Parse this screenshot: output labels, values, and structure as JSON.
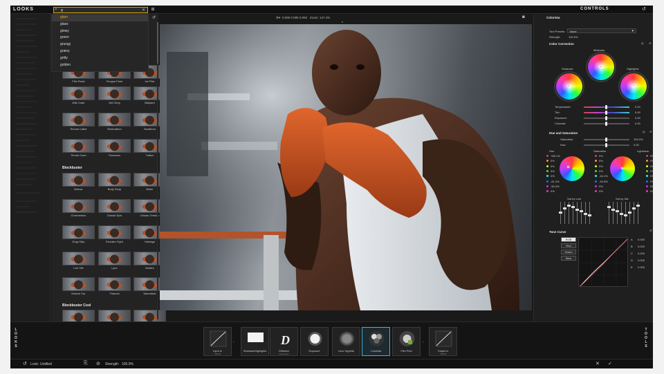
{
  "header": {
    "looks_title": "LOOKS",
    "controls_title": "CONTROLS"
  },
  "search": {
    "value": "g",
    "options": [
      "glam",
      "glass",
      "glowy",
      "green",
      "grungy",
      "grainy",
      "gritty",
      "golden"
    ],
    "selected": "glam"
  },
  "looks": {
    "rows": [
      [
        "Film Flash",
        "Fungus Farm",
        "Ice Pick"
      ],
      [
        "Milk Crate",
        "Old Glory",
        "Ballyard"
      ],
      [
        "Record Label",
        "Restoration",
        "Sandborn"
      ],
      [
        "Tennis Court",
        "Transonic",
        "Tuition"
      ],
      [
        "Bolivar",
        "Body Shop",
        "Boiler"
      ],
      [
        "Chromeleon",
        "Classic Epic",
        "Classic Tension"
      ],
      [
        "Drag Strip",
        "Elevator Fight",
        "Heritage"
      ],
      [
        "Live Die",
        "Lyon",
        "Mantra"
      ],
      [
        "Muscle Car",
        "Thames",
        "Warmfade"
      ]
    ],
    "groups": [
      "Blockbuster",
      "Blockbuster Cool"
    ]
  },
  "viewer": {
    "readout": "0.096   0.095   0.092",
    "zoom_label": "Zoom:",
    "zoom_value": "147.4%"
  },
  "controls": {
    "section_title": "Colorista",
    "tool_presets_label": "Tool Presets:",
    "tool_presets_value": "None",
    "strength_label": "Strength:",
    "strength_value": "100.0%",
    "color_correction": "Color Correction",
    "midtones": "Midtones",
    "shadows": "Shadows",
    "highlights": "Highlights",
    "sliders": [
      {
        "label": "Temperature:",
        "value": "0.00"
      },
      {
        "label": "Tint:",
        "value": "0.00"
      },
      {
        "label": "Exposure:",
        "value": "0.00"
      },
      {
        "label": "Contrast:",
        "value": "0.00"
      }
    ],
    "hue_sat": "Hue and Saturation",
    "hs_sliders": [
      {
        "label": "Saturation:",
        "value": "100.0%"
      },
      {
        "label": "Hue:",
        "value": "0.00"
      }
    ],
    "hue_label": "Hue",
    "saturation_label": "Saturation",
    "lightness_label": "Lightness",
    "hue_vals": [
      "+58.1%",
      "0%",
      "0%",
      "0%",
      "0%",
      "-61.2%",
      "-50.3%",
      "0%"
    ],
    "sat_vals": [
      "0%",
      "0%",
      "0%",
      "0%",
      "-16.1%",
      "-16.5%",
      "0%",
      "0%"
    ],
    "light_vals": [
      "0%",
      "0%",
      "0%",
      "0%",
      "0%",
      "0%",
      "0%",
      "0%"
    ],
    "sat_by_lum": "Sat by Lum",
    "sat_by_sat": "Sat by Sat",
    "tone_curve": "Tone Curve",
    "tone_buttons": [
      "RGB",
      "Red",
      "Green",
      "Blue"
    ],
    "tone_vals": [
      "0.000",
      "0.000",
      "0.000",
      "0.000",
      "0.000"
    ],
    "tone_letters": [
      "A",
      "B",
      "C",
      "D",
      "E"
    ]
  },
  "tools": [
    {
      "label": "Input lo",
      "sub": "VRGB"
    },
    {
      "label": "Shadows/Highlights",
      "sub": ""
    },
    {
      "label": "Diffusion",
      "sub": "Input Gain"
    },
    {
      "label": "Exposure",
      "sub": ""
    },
    {
      "label": "Lens Vignette",
      "sub": ""
    },
    {
      "label": "Colorista",
      "sub": ""
    },
    {
      "label": "Film Print",
      "sub": ""
    },
    {
      "label": "Output lo",
      "sub": "VRGB"
    }
  ],
  "side_tabs": {
    "left": "LOOKS",
    "right": "TOOLS"
  },
  "status": {
    "look_label": "Look:",
    "look_value": "Untitled",
    "strength_label": "Strength:",
    "strength_value": "100.0%"
  },
  "colors": {
    "accent_yellow": "#e0b000",
    "active_tool": "#3fb6d9"
  }
}
